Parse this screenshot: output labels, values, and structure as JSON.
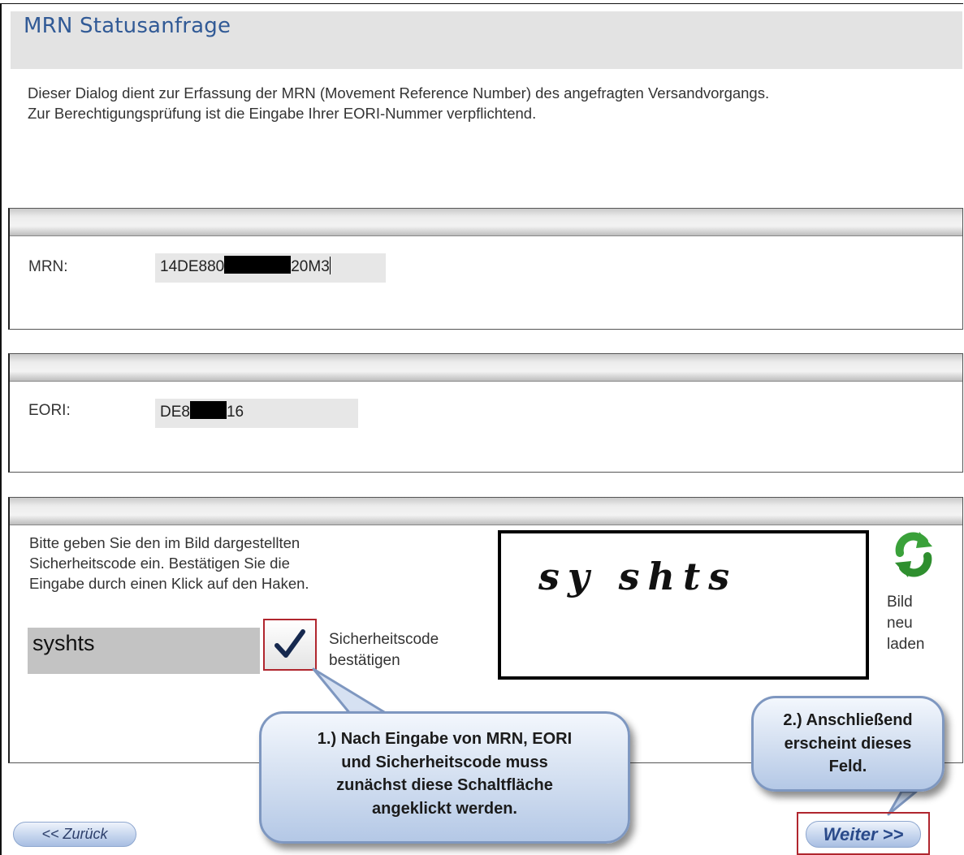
{
  "page": {
    "title": "MRN Statusanfrage",
    "intro_line1": "Dieser Dialog dient zur Erfassung der MRN (Movement Reference Number) des angefragten Versandvorgangs.",
    "intro_line2": "Zur Berechtigungsprüfung ist die Eingabe Ihrer EORI-Nummer verpflichtend."
  },
  "mrn": {
    "label": "MRN:",
    "value_prefix": "14DE880",
    "value_suffix": "20M3"
  },
  "eori": {
    "label": "EORI:",
    "value_prefix": "DE8",
    "value_suffix": "16"
  },
  "captcha": {
    "instruction_line1": "Bitte geben Sie den im Bild dargestellten",
    "instruction_line2": "Sicherheitscode ein. Bestätigen Sie die",
    "instruction_line3": "Eingabe durch einen Klick auf den Haken.",
    "input_value": "syshts",
    "confirm_label_line1": "Sicherheitscode",
    "confirm_label_line2": "bestätigen",
    "image_text": "sy shts",
    "reload_line1": "Bild",
    "reload_line2": "neu",
    "reload_line3": "laden"
  },
  "nav": {
    "back_label": "<< Zurück",
    "next_label": "Weiter >>"
  },
  "callouts": {
    "first_line1": "1.) Nach Eingabe von MRN, EORI",
    "first_line2": "und Sicherheitscode muss",
    "first_line3": "zunächst diese Schaltfläche",
    "first_line4": "angeklickt werden.",
    "second_line1": "2.) Anschließend",
    "second_line2": "erscheint dieses",
    "second_line3": "Feld."
  },
  "icons": {
    "confirm": "checkmark-icon",
    "reload": "refresh-icon"
  },
  "colors": {
    "title": "#315a96",
    "highlight_border": "#b0262e",
    "reload_green": "#3aa13a",
    "callout_border": "#7e97c0"
  }
}
